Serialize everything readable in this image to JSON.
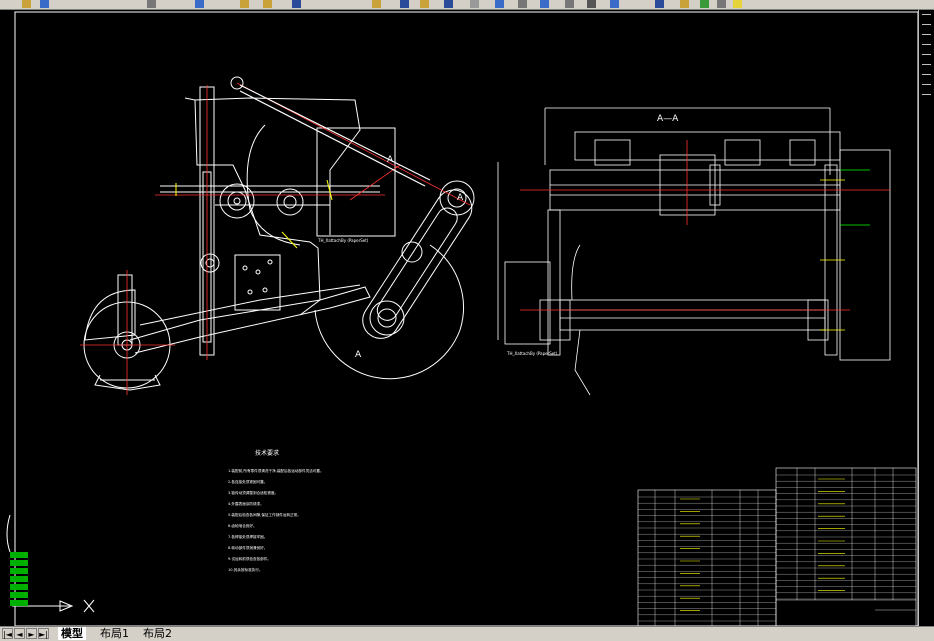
{
  "window": {
    "title": ""
  },
  "tabs": [
    {
      "label": "模型",
      "active": true
    },
    {
      "label": "布局1",
      "active": false
    },
    {
      "label": "布局2",
      "active": false
    }
  ],
  "drawing": {
    "section_label": "A—A",
    "section_marker_left": "A",
    "section_marker_right": "A",
    "view_marker_bottom": "A",
    "leader_text_1": "TH_XattachBy (PaperSet)",
    "leader_text_2": "TH_XattachBy (PaperSet)",
    "notes_title": "技术要求",
    "notes_lines": [
      "1.装配前,所有零件须清洗干净,装配后各运动部件灵活可靠。",
      "2.各连接处须紧固可靠。",
      "3.链传动须调整到合适松紧度。",
      "4.外露表面涂防锈漆。",
      "5.装配后检查各间隙,保证工作部件运转正常。",
      "6.齿轮啮合良好。",
      "7.各焊接处须焊接牢固。",
      "8.转动部件须润滑良好。",
      "9.试运转前须检查各部件。",
      "10.其余按标准执行。"
    ],
    "colors": {
      "line": "#ffffff",
      "center_line": "#ff3333",
      "accent": "#00ff00",
      "yellow": "#ffff00",
      "cyan": "#00ffff"
    }
  },
  "controls": {
    "nav_first": "|◄",
    "nav_prev": "◄",
    "nav_next": "►",
    "nav_last": "►|"
  }
}
